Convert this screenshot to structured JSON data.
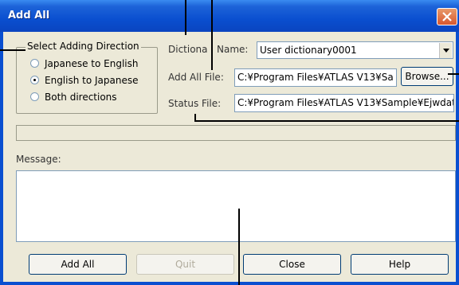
{
  "window": {
    "title": "Add All"
  },
  "direction_group": {
    "legend": "Select Adding Direction",
    "options": [
      {
        "label": "Japanese to English",
        "selected": false
      },
      {
        "label": "English to Japanese",
        "selected": true
      },
      {
        "label": "Both directions",
        "selected": false
      }
    ]
  },
  "dictionary": {
    "label_left": "Dictiona",
    "label_right": "Name:",
    "value": "User dictionary0001"
  },
  "add_all_file": {
    "label": "Add All File:",
    "value": "C:¥Program Files¥ATLAS V13¥Sa"
  },
  "browse_button": {
    "label": "Browse..."
  },
  "status_file": {
    "label": "Status File:",
    "value": "C:¥Program Files¥ATLAS V13¥Sample¥Ejwdat"
  },
  "message": {
    "label": "Message:",
    "text": ""
  },
  "buttons": {
    "add_all": "Add All",
    "quit": "Quit",
    "close": "Close",
    "help": "Help"
  },
  "colors": {
    "titlebar": "#0a4fd0",
    "dialog_bg": "#ece9d8",
    "close_button": "#d8572e"
  }
}
